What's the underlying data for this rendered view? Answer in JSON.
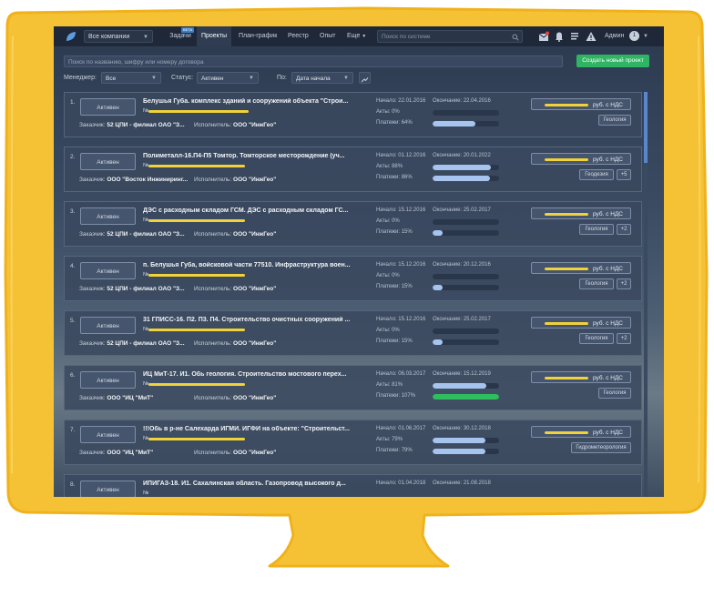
{
  "colors": {
    "frame": "#f6c235",
    "topbar": "#1e2838",
    "accent_green": "#2fb463",
    "bar_fill": "#a6c4ee",
    "bar_green": "#2fbe5f",
    "highlight": "#f1d23a"
  },
  "topbar": {
    "company_select": "Все компании",
    "nav": [
      {
        "label": "Задачи"
      },
      {
        "label": "Проекты"
      },
      {
        "label": "План-график"
      },
      {
        "label": "Реестр"
      },
      {
        "label": "Опыт"
      },
      {
        "label": "Еще"
      }
    ],
    "beta_badge": "BETA",
    "search_placeholder": "Поиск по системе",
    "user_name": "Админ",
    "avatar_glyph": "1",
    "icons": [
      "inbox-icon",
      "bell-icon",
      "list-icon",
      "warning-icon"
    ]
  },
  "filters": {
    "search_placeholder": "Поиск по названию, шифру или номеру договора",
    "create_button": "Создать новый проект",
    "manager_label": "Менеджер:",
    "manager_value": "Все",
    "status_label": "Статус:",
    "status_value": "Активен",
    "sort_label": "По:",
    "sort_value": "Дата начала"
  },
  "labels": {
    "start": "Начало:",
    "end": "Окончание:",
    "acts": "Акты:",
    "payments": "Платежи:",
    "customer": "Заказчик:",
    "executor": "Исполнитель:",
    "price_suffix": "руб. с НДС",
    "contract_prefix": "№"
  },
  "projects": [
    {
      "num": "1.",
      "status": "Активен",
      "title": "Белушья Губа. комплекс зданий и сооружений объекта \"Строи...",
      "customer": "52 ЦПИ - филиал ОАО \"З...",
      "executor": "ООО \"ИнжГео\"",
      "start": "22.01.2016",
      "end": "22.04.2016",
      "acts": "0%",
      "payments": "64%",
      "acts_value": 0,
      "payments_value": 64,
      "tags": [
        "Геология"
      ]
    },
    {
      "num": "2.",
      "status": "Активен",
      "title": "Полиметалл-16.П4-П5 Томтор. Томторское месторождение (уч...",
      "customer": "ООО \"Восток Инжиниринг...",
      "executor": "ООО \"ИнжГео\"",
      "start": "01.12.2016",
      "end": "20.01.2022",
      "acts": "88%",
      "payments": "86%",
      "acts_value": 88,
      "payments_value": 86,
      "tags": [
        "Геодезия",
        "+5"
      ]
    },
    {
      "num": "3.",
      "status": "Активен",
      "title": "ДЭС с расходным складом ГСМ. ДЭС с расходным складом ГС...",
      "customer": "52 ЦПИ - филиал ОАО \"З...",
      "executor": "ООО \"ИнжГео\"",
      "start": "15.12.2016",
      "end": "25.02.2017",
      "acts": "0%",
      "payments": "15%",
      "acts_value": 0,
      "payments_value": 15,
      "tags": [
        "Геология",
        "+2"
      ]
    },
    {
      "num": "4.",
      "status": "Активен",
      "title": "п. Белушья Губа, войсковой части 77510. Инфраструктура воен...",
      "customer": "52 ЦПИ - филиал ОАО \"З...",
      "executor": "ООО \"ИнжГео\"",
      "start": "15.12.2016",
      "end": "20.12.2016",
      "acts": "0%",
      "payments": "15%",
      "acts_value": 0,
      "payments_value": 15,
      "tags": [
        "Геология",
        "+2"
      ]
    },
    {
      "num": "5.",
      "status": "Активен",
      "title": "31 ГПИСС-16. П2. П3. П4. Строительство очистных сооружений ...",
      "customer": "52 ЦПИ - филиал ОАО \"З...",
      "executor": "ООО \"ИнжГео\"",
      "start": "15.12.2016",
      "end": "25.02.2017",
      "acts": "0%",
      "payments": "15%",
      "acts_value": 0,
      "payments_value": 15,
      "tags": [
        "Геология",
        "+2"
      ]
    },
    {
      "num": "6.",
      "status": "Активен",
      "title": "ИЦ МиТ-17. И1. Обь геология. Строительство мостового перех...",
      "customer": "ООО \"ИЦ \"МиТ\"",
      "executor": "ООО \"ИнжГео\"",
      "start": "06.03.2017",
      "end": "15.12.2019",
      "acts": "81%",
      "payments": "107%",
      "acts_value": 81,
      "payments_value": 107,
      "tags": [
        "Геология"
      ]
    },
    {
      "num": "7.",
      "status": "Активен",
      "title": "!!!Обь в р-не Салехарда ИГМИ. ИГФИ на объекте: \"Строительст...",
      "customer": "ООО \"ИЦ \"МиТ\"",
      "executor": "ООО \"ИнжГео\"",
      "start": "01.06.2017",
      "end": "30.12.2018",
      "acts": "79%",
      "payments": "79%",
      "acts_value": 79,
      "payments_value": 79,
      "tags": [
        "Гидрометеорология"
      ]
    },
    {
      "num": "8.",
      "status": "Активен",
      "title": "ИПИГАЗ-18. И1. Сахалинская область. Газопровод высокого д...",
      "customer": "",
      "executor": "",
      "start": "01.04.2018",
      "end": "21.08.2018",
      "acts": "",
      "payments": "",
      "acts_value": 0,
      "payments_value": 0,
      "tags": []
    }
  ]
}
